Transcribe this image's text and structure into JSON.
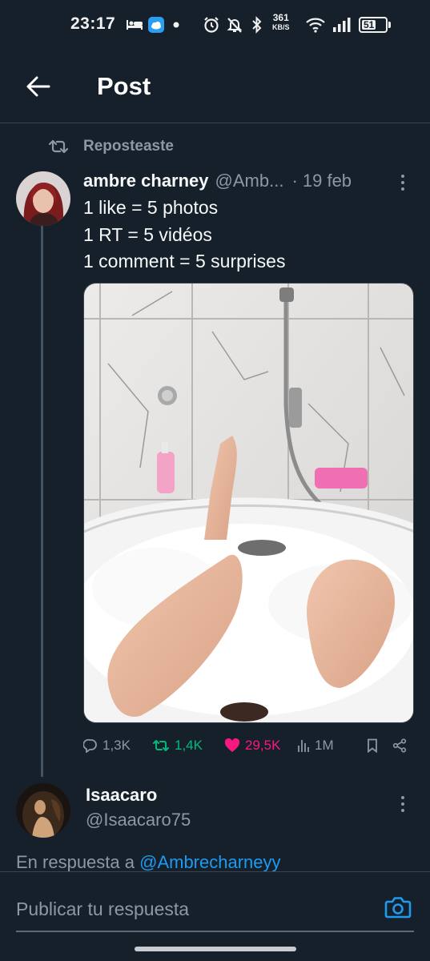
{
  "status_bar": {
    "time": "23:17",
    "net_speed": "361",
    "net_speed_unit": "KB/S",
    "battery": "51",
    "icons": [
      "sleep-icon",
      "weather-icon",
      "dot-icon",
      "alarm-icon",
      "mute-icon",
      "bluetooth-icon",
      "wifi-icon",
      "signal-icon",
      "battery-icon"
    ]
  },
  "header": {
    "title": "Post",
    "back_icon": "arrow-left-icon"
  },
  "repost": {
    "label": "Reposteaste",
    "icon": "repost-icon"
  },
  "tweet": {
    "author_name": "ambre charney",
    "author_handle": "@Amb...",
    "date": "· 19 feb",
    "lines": [
      "1 like = 5 photos",
      "1 RT = 5 vidéos",
      "1 comment = 5 surprises"
    ],
    "media_icon": "photo-image",
    "stats": {
      "replies": "1,3K",
      "reposts": "1,4K",
      "likes": "29,5K",
      "views": "1M"
    },
    "colors": {
      "repost": "#00ba7c",
      "like": "#f91880",
      "muted": "#8b98a5"
    }
  },
  "reply": {
    "author_name": "Isaacaro",
    "author_handle": "@Isaacaro75",
    "reply_prefix": "En respuesta a",
    "mention": "@Ambrecharneyy"
  },
  "composer": {
    "placeholder": "Publicar tu respuesta",
    "camera_icon": "camera-icon",
    "accent": "#1d9bf0"
  }
}
